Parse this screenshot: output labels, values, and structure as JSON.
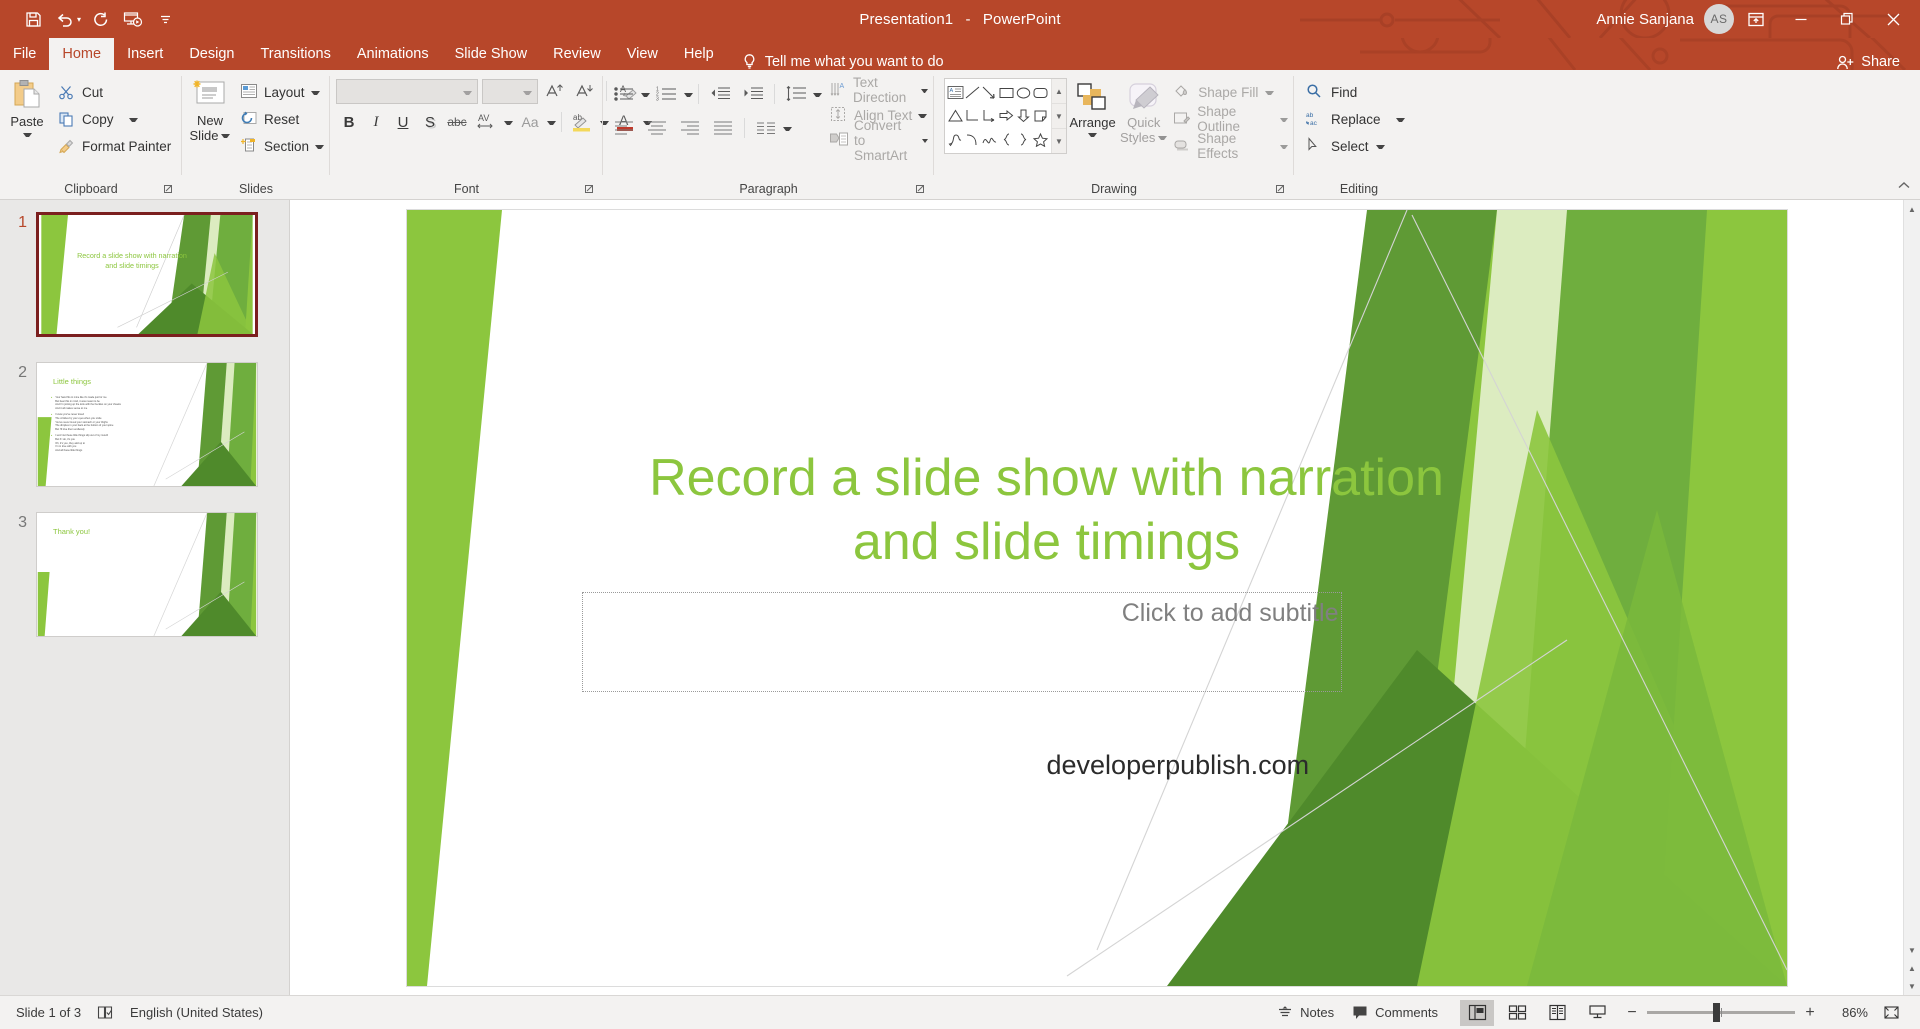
{
  "titlebar": {
    "document_title": "Presentation1",
    "app_name": "PowerPoint",
    "separator": "-",
    "user_name": "Annie Sanjana",
    "avatar_initials": "AS",
    "qat": [
      {
        "name": "save",
        "label": "Save"
      },
      {
        "name": "undo",
        "label": "Undo"
      },
      {
        "name": "redo",
        "label": "Repeat"
      },
      {
        "name": "start-from-beginning",
        "label": "Start From Beginning"
      },
      {
        "name": "customize-qat",
        "label": "Customize Quick Access Toolbar"
      }
    ],
    "window_controls": [
      {
        "name": "ribbon-display-options",
        "label": "Ribbon Display Options"
      },
      {
        "name": "minimize",
        "label": "Minimize"
      },
      {
        "name": "restore",
        "label": "Restore Down"
      },
      {
        "name": "close",
        "label": "Close"
      }
    ]
  },
  "tabs": [
    {
      "label": "File",
      "active": false
    },
    {
      "label": "Home",
      "active": true
    },
    {
      "label": "Insert",
      "active": false
    },
    {
      "label": "Design",
      "active": false
    },
    {
      "label": "Transitions",
      "active": false
    },
    {
      "label": "Animations",
      "active": false
    },
    {
      "label": "Slide Show",
      "active": false
    },
    {
      "label": "Review",
      "active": false
    },
    {
      "label": "View",
      "active": false
    },
    {
      "label": "Help",
      "active": false
    }
  ],
  "tellme": {
    "text": "Tell me what you want to do"
  },
  "share": {
    "label": "Share"
  },
  "ribbon": {
    "groups": [
      {
        "name": "clipboard",
        "label": "Clipboard"
      },
      {
        "name": "slides",
        "label": "Slides"
      },
      {
        "name": "font",
        "label": "Font"
      },
      {
        "name": "paragraph",
        "label": "Paragraph"
      },
      {
        "name": "drawing",
        "label": "Drawing"
      },
      {
        "name": "editing",
        "label": "Editing"
      }
    ],
    "clipboard": {
      "paste_label": "Paste",
      "cut_label": "Cut",
      "copy_label": "Copy",
      "format_painter_label": "Format Painter"
    },
    "slides": {
      "new_slide_line1": "New",
      "new_slide_line2": "Slide",
      "layout_label": "Layout",
      "reset_label": "Reset",
      "section_label": "Section"
    },
    "font": {
      "font_name_value": "",
      "font_size_value": "",
      "bold_label": "B",
      "italic_label": "I",
      "underline_label": "U",
      "shadow_label": "S",
      "strikethrough_label": "abc",
      "char_spacing_label": "AV",
      "change_case_label": "Aa",
      "increase_size_label": "A",
      "decrease_size_label": "A",
      "clear_formatting_label": "A",
      "text_highlight_label": "ab",
      "font_color_label": "A"
    },
    "paragraph": {
      "text_direction_label": "Text Direction",
      "align_text_label": "Align Text",
      "convert_smartart_label": "Convert to SmartArt"
    },
    "drawing": {
      "arrange_label": "Arrange",
      "quick_styles_line1": "Quick",
      "quick_styles_line2": "Styles",
      "shape_fill_label": "Shape Fill",
      "shape_outline_label": "Shape Outline",
      "shape_effects_label": "Shape Effects"
    },
    "editing": {
      "find_label": "Find",
      "replace_label": "Replace",
      "select_label": "Select"
    }
  },
  "thumbnails": [
    {
      "number": "1",
      "selected": true,
      "title": "Record a slide show with narration and slide timings",
      "kind": "title"
    },
    {
      "number": "2",
      "selected": false,
      "title": "Little things",
      "kind": "bullets",
      "bullets": [
        [
          "Your hand fits in mine like it's made just for me",
          "But bear this in mind, it was meant to be",
          "And I'm joining up the dots with the freckles on your cheeks",
          "And it all makes sense to me"
        ],
        [
          "I know you've never loved",
          "The crinkles by your eyes when you smile",
          "You've never loved your stomach or your thighs",
          "The dimples in your back at the bottom of your spine",
          "But I'll love them endlessly"
        ],
        [
          "I won't let these little things slip out of my mouth",
          "But if I do, it's you",
          "Oh, it's you, they add up to",
          "I'm in love with you",
          "And all these little things"
        ]
      ]
    },
    {
      "number": "3",
      "selected": false,
      "title": "Thank you!",
      "kind": "title-only"
    }
  ],
  "slide": {
    "title": "Record a slide show with narration and slide timings",
    "subtitle_placeholder": "Click to add subtitle",
    "footer_text": "developerpublish.com",
    "title_color": "#8cc63e",
    "placeholder_color": "#808080"
  },
  "statusbar": {
    "slide_indicator": "Slide 1 of 3",
    "language": "English (United States)",
    "notes_label": "Notes",
    "comments_label": "Comments",
    "zoom_percent": "86%",
    "views": [
      {
        "name": "normal-view",
        "label": "Normal",
        "active": true
      },
      {
        "name": "slide-sorter-view",
        "label": "Slide Sorter",
        "active": false
      },
      {
        "name": "reading-view",
        "label": "Reading View",
        "active": false
      },
      {
        "name": "slide-show-view",
        "label": "Slide Show",
        "active": false
      }
    ],
    "zoom_out_label": "−",
    "zoom_in_label": "+",
    "fit_label": "Fit slide to current window"
  },
  "theme": {
    "accent": "#b7472a",
    "ribbon_bg": "#f3f2f1",
    "green_light": "#8cc63e",
    "green_mid": "#6aa63b",
    "green_dark": "#4f7d2a"
  }
}
